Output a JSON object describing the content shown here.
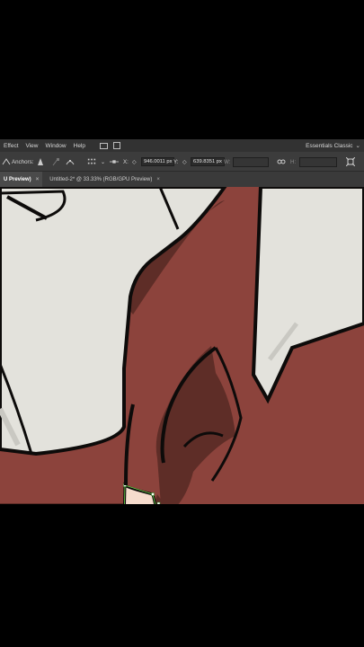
{
  "menu": {
    "items": [
      "Effect",
      "View",
      "Window",
      "Help"
    ],
    "workspace": "Essentials Classic"
  },
  "control": {
    "anchors_label": "Anchors:",
    "x_label": "X:",
    "x_value": "946.0011 px",
    "y_label": "Y:",
    "y_value": "639.8351 px",
    "w_label": "W:",
    "h_label": "H:"
  },
  "tabs": [
    {
      "label": "U Preview)",
      "active": true,
      "close": "×"
    },
    {
      "label": "Untitled-2* @ 33.33% (RGB/GPU Preview)",
      "active": false,
      "close": "×"
    }
  ],
  "colors": {
    "skin_dark": "#8c433c",
    "shadow": "#5e2d27",
    "cloth": "#e3e2dc",
    "cloth_shade": "#c9c8c2",
    "fill_selected": "#f6dccd",
    "outline": "#0d0b0a",
    "anchor": "#69d94b"
  }
}
